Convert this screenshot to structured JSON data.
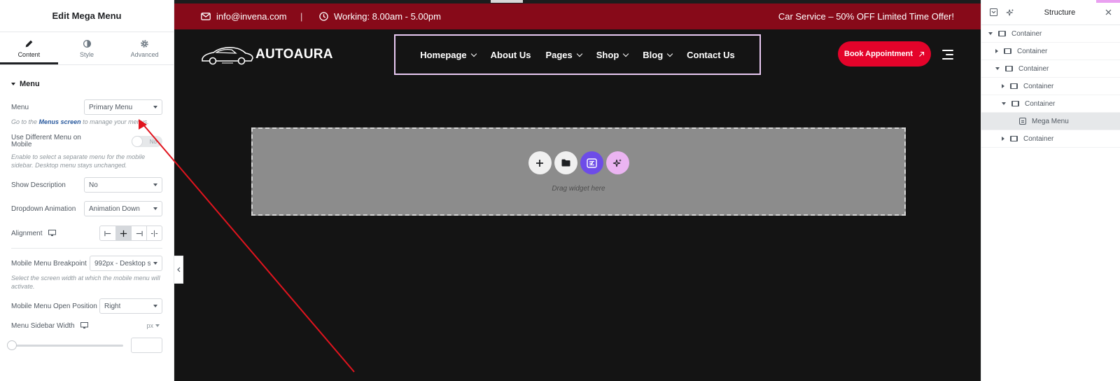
{
  "left_panel": {
    "title": "Edit Mega Menu",
    "tabs": [
      {
        "label": "Content",
        "icon": "pencil-icon"
      },
      {
        "label": "Style",
        "icon": "half-circle-icon"
      },
      {
        "label": "Advanced",
        "icon": "gear-icon"
      }
    ],
    "section_title": "Menu",
    "menu_label": "Menu",
    "menu_value": "Primary Menu",
    "menu_help_prefix": "Go to the",
    "menu_help_link": "Menus screen",
    "menu_help_suffix": "to manage your menus.",
    "diff_mobile_label": "Use Different Menu on Mobile",
    "diff_mobile_toggle": "No",
    "diff_mobile_help": "Enable to select a separate menu for the mobile sidebar. Desktop menu stays unchanged.",
    "show_desc_label": "Show Description",
    "show_desc_value": "No",
    "dropdown_anim_label": "Dropdown Animation",
    "dropdown_anim_value": "Animation Down",
    "alignment_label": "Alignment",
    "breakpoint_label": "Mobile Menu Breakpoint",
    "breakpoint_value": "992px - Desktop si",
    "breakpoint_help": "Select the screen width at which the mobile menu will activate.",
    "open_pos_label": "Mobile Menu Open Position",
    "open_pos_value": "Right",
    "sidebar_width_label": "Menu Sidebar Width",
    "sidebar_width_unit": "px"
  },
  "topbar": {
    "email": "info@invena.com",
    "separator": "|",
    "hours": "Working: 8.00am - 5.00pm",
    "promo": "Car Service – 50% OFF Limited Time Offer!"
  },
  "header": {
    "logo_text": "AUTOAURA",
    "nav": [
      {
        "label": "Homepage",
        "has_dropdown": true
      },
      {
        "label": "About Us",
        "has_dropdown": false
      },
      {
        "label": "Pages",
        "has_dropdown": true
      },
      {
        "label": "Shop",
        "has_dropdown": true
      },
      {
        "label": "Blog",
        "has_dropdown": true
      },
      {
        "label": "Contact Us",
        "has_dropdown": false
      }
    ],
    "cta": "Book Appointment"
  },
  "drop_zone": {
    "text": "Drag widget here"
  },
  "structure": {
    "title": "Structure",
    "items": [
      {
        "label": "Container",
        "state": "expanded"
      },
      {
        "label": "Container",
        "state": "collapsed"
      },
      {
        "label": "Container",
        "state": "expanded"
      },
      {
        "label": "Container",
        "state": "collapsed"
      },
      {
        "label": "Container",
        "state": "expanded"
      },
      {
        "label": "Mega Menu",
        "state": "leaf"
      },
      {
        "label": "Container",
        "state": "collapsed"
      }
    ]
  },
  "colors": {
    "topbar_bg": "#870a19",
    "canvas_bg": "#141414",
    "cta_bg": "#e4032a",
    "nav_outline": "#e9c9f3",
    "annotation_arrow": "#e0141e"
  }
}
